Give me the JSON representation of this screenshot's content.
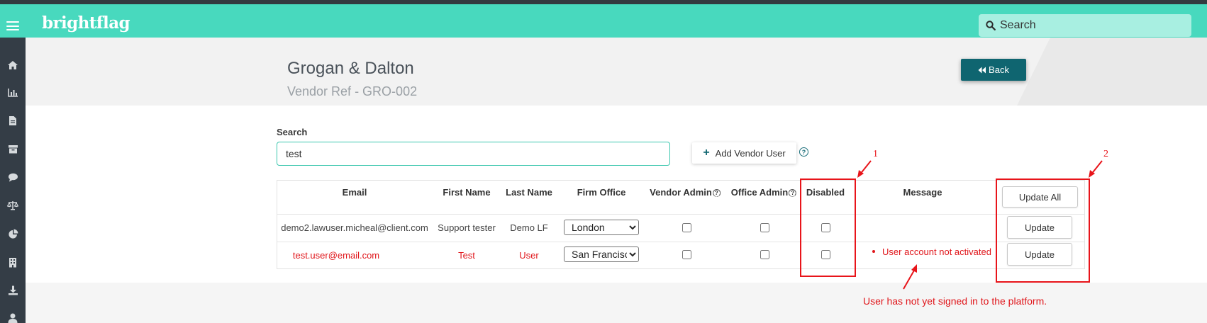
{
  "app": {
    "logo": "brightflag"
  },
  "topbar": {
    "search_placeholder": "Search"
  },
  "sidebar": {
    "icons": [
      "home-icon",
      "analytics-icon",
      "document-icon",
      "archive-icon",
      "chat-icon",
      "scales-icon",
      "pie-chart-icon",
      "building-icon",
      "download-icon",
      "user-icon"
    ]
  },
  "header": {
    "title": "Grogan & Dalton",
    "vendor_ref": "Vendor Ref - GRO-002",
    "back_label": "Back"
  },
  "search": {
    "label": "Search",
    "value": "test"
  },
  "add_vendor_user": {
    "label": "Add Vendor User"
  },
  "table": {
    "columns": {
      "email": "Email",
      "first_name": "First Name",
      "last_name": "Last Name",
      "firm_office": "Firm Office",
      "vendor_admin": "Vendor Admin",
      "office_admin": "Office Admin",
      "disabled": "Disabled",
      "message": "Message",
      "update_all": "Update All"
    },
    "rows": [
      {
        "email": "demo2.lawuser.micheal@client.com",
        "first_name": "Support tester",
        "last_name": "Demo LF",
        "firm_office": "London",
        "vendor_admin": false,
        "office_admin": false,
        "disabled": false,
        "message": "",
        "update_label": "Update",
        "status_color": "#444444"
      },
      {
        "email": "test.user@email.com",
        "first_name": "Test",
        "last_name": "User",
        "firm_office": "San Francisco",
        "vendor_admin": false,
        "office_admin": false,
        "disabled": false,
        "message": "User account not activated",
        "update_label": "Update",
        "status_color": "#e0161b"
      }
    ]
  },
  "annotations": {
    "marker_1": "1",
    "marker_2": "2",
    "note": "User has not yet signed in to the platform.",
    "color": "#e8141a"
  },
  "colors": {
    "brand": "#48d9be",
    "sidebar": "#343d46",
    "back_button": "#0f6570",
    "error": "#e0161b"
  }
}
